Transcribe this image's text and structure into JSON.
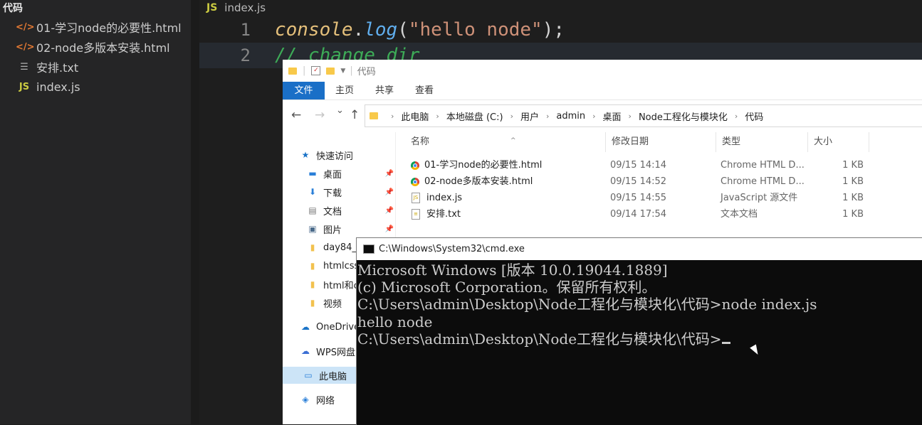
{
  "sidebar": {
    "title": "代码",
    "files": [
      {
        "icon": "</>",
        "name": "01-学习node的必要性.html"
      },
      {
        "icon": "</>",
        "name": "02-node多版本安装.html"
      },
      {
        "icon": "☰",
        "name": "安排.txt"
      },
      {
        "icon": "JS",
        "name": "index.js"
      }
    ]
  },
  "editor": {
    "tab": {
      "icon": "JS",
      "filename": "index.js"
    },
    "lines": [
      {
        "number": "1",
        "obj": "console",
        "dot": ".",
        "fn": "log",
        "open": "(",
        "str": "\"hello node\"",
        "close": ");"
      },
      {
        "number": "2",
        "comment": "// change dir"
      }
    ]
  },
  "explorer": {
    "title": "代码",
    "ribbon_tabs": [
      "文件",
      "主页",
      "共享",
      "查看"
    ],
    "nav_buttons": {
      "back": "←",
      "forward": "→",
      "recent": "⌄",
      "up": "↑"
    },
    "breadcrumb": [
      "此电脑",
      "本地磁盘 (C:)",
      "用户",
      "admin",
      "桌面",
      "Node工程化与模块化",
      "代码"
    ],
    "nav_pane": [
      {
        "icon": "★",
        "label": "快速访问"
      },
      {
        "icon": "▬",
        "label": "桌面",
        "pinned": true
      },
      {
        "icon": "⬇",
        "label": "下载",
        "pinned": true
      },
      {
        "icon": "▤",
        "label": "文档",
        "pinned": true
      },
      {
        "icon": "▣",
        "label": "图片",
        "pinned": true
      },
      {
        "icon": "▮",
        "label": "day84_"
      },
      {
        "icon": "▮",
        "label": "htmlcss"
      },
      {
        "icon": "▮",
        "label": "html和c"
      },
      {
        "icon": "▮",
        "label": "视频"
      },
      {
        "icon": "☁",
        "label": "OneDrive"
      },
      {
        "icon": "☁",
        "label": "WPS网盘"
      },
      {
        "icon": "▭",
        "label": "此电脑"
      },
      {
        "icon": "◈",
        "label": "网络"
      }
    ],
    "columns": [
      "名称",
      "修改日期",
      "类型",
      "大小"
    ],
    "files": [
      {
        "name": "01-学习node的必要性.html",
        "date": "09/15 14:14",
        "type": "Chrome HTML D...",
        "size": "1 KB"
      },
      {
        "name": "02-node多版本安装.html",
        "date": "09/15 14:52",
        "type": "Chrome HTML D...",
        "size": "1 KB"
      },
      {
        "name": "index.js",
        "date": "09/15 14:55",
        "type": "JavaScript 源文件",
        "size": "1 KB"
      },
      {
        "name": "安排.txt",
        "date": "09/14 17:54",
        "type": "文本文档",
        "size": "1 KB"
      }
    ]
  },
  "cmd": {
    "title": "C:\\Windows\\System32\\cmd.exe",
    "lines": [
      "Microsoft Windows [版本 10.0.19044.1889]",
      "(c) Microsoft Corporation。保留所有权利。",
      "",
      "C:\\Users\\admin\\Desktop\\Node工程化与模块化\\代码>node index.js",
      "hello node",
      "",
      "C:\\Users\\admin\\Desktop\\Node工程化与模块化\\代码>"
    ]
  }
}
